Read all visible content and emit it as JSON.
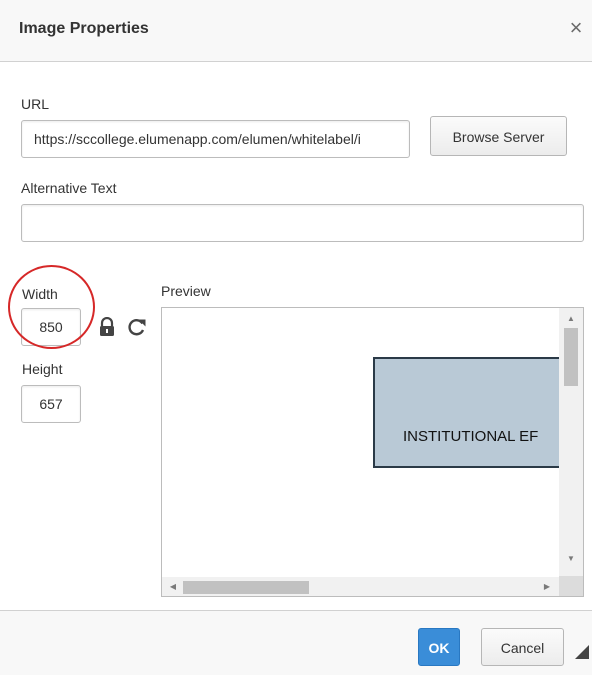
{
  "dialog": {
    "title": "Image Properties",
    "close_symbol": "×"
  },
  "url": {
    "label": "URL",
    "value": "https://sccollege.elumenapp.com/elumen/whitelabel/i"
  },
  "browse_button": "Browse Server",
  "alt_text": {
    "label": "Alternative Text",
    "value": ""
  },
  "size": {
    "width_label": "Width",
    "width_value": "850",
    "height_label": "Height",
    "height_value": "657",
    "lock_icon": "lock-icon",
    "reset_icon": "reset-size-icon"
  },
  "preview": {
    "label": "Preview",
    "image_text": "INSTITUTIONAL EF"
  },
  "footer": {
    "ok_label": "OK",
    "cancel_label": "Cancel"
  },
  "colors": {
    "ok_button": "#3a8dd8",
    "annotation": "#d62828",
    "preview_fill": "#b9c9d6"
  }
}
